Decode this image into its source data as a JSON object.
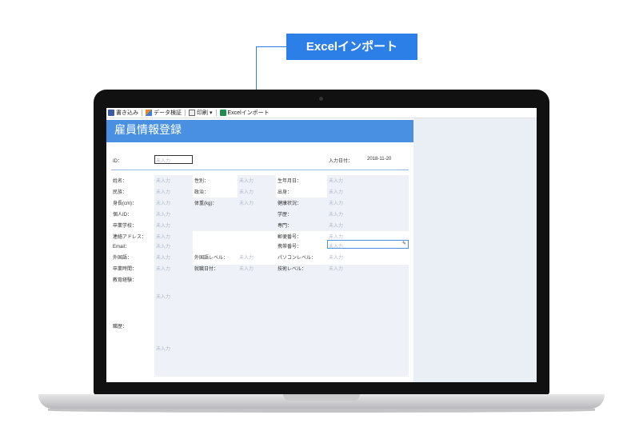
{
  "callout": {
    "label": "Excelインポート"
  },
  "toolbar": {
    "write": "書き込み",
    "verify": "データ検証",
    "print": "印刷",
    "print_caret": "▾",
    "excel_import": "Excelインポート"
  },
  "form": {
    "title": "雇員情報登録",
    "placeholder": "未入力",
    "id_label": "ID：",
    "date_label": "入力日付：",
    "date_value": "2018-11-20",
    "fields": {
      "name": "姓名：",
      "gender": "性別：",
      "birth": "生年月日：",
      "ethnicity": "民族：",
      "politics": "政治：",
      "origin": "出身：",
      "height": "身長(cm)：",
      "weight": "体重(kg)：",
      "health": "健康状況：",
      "personal_id": "個人ID：",
      "education": "学歴：",
      "school": "卒業学校：",
      "major": "専門：",
      "address": "連絡アドレス：",
      "postal": "郵便番号：",
      "email": "Email：",
      "phone": "携帯番号：",
      "language": "外国語：",
      "language_level": "外国語レベル：",
      "pc_level": "パソコンレベル：",
      "grad_date": "卒業時間：",
      "job_date": "就職日付：",
      "skill_level": "技術レベル：",
      "edu_history": "教育経験：",
      "work_history": "職歴："
    }
  }
}
